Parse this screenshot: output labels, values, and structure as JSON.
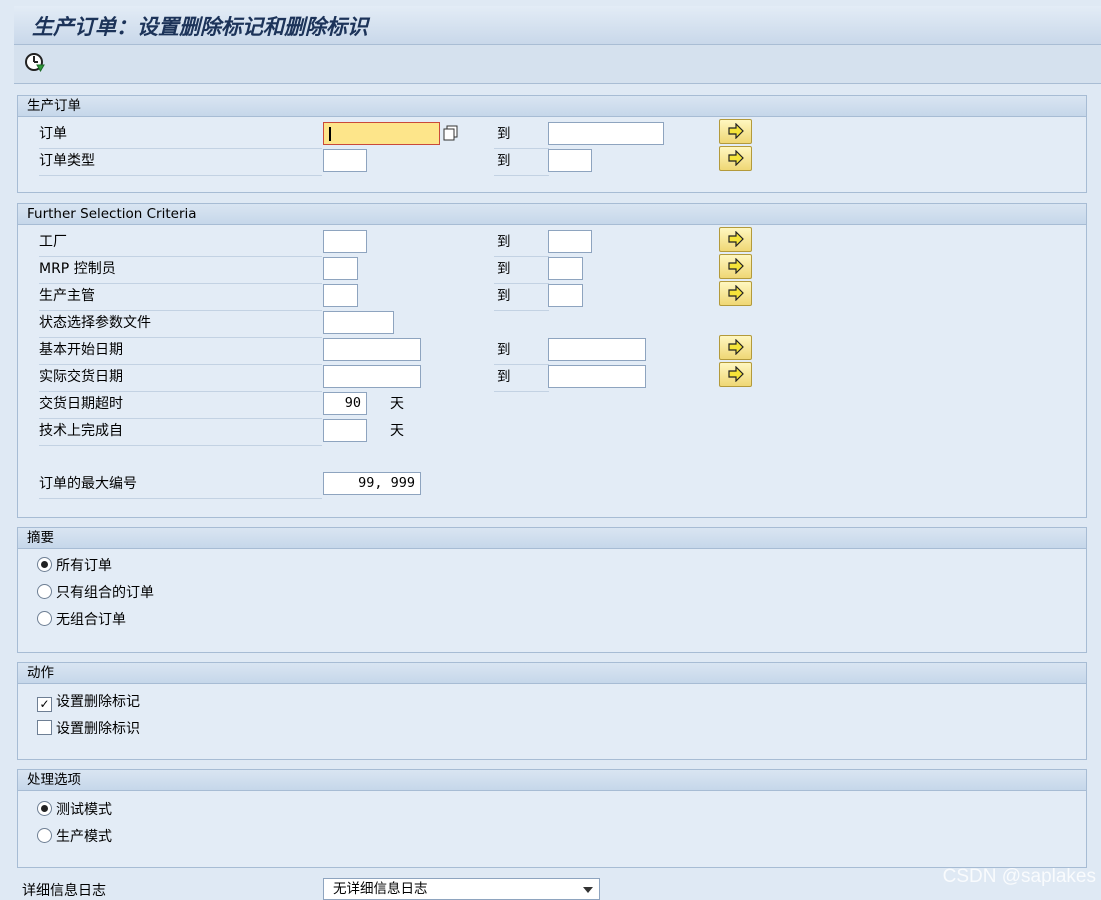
{
  "window": {
    "title": "生产订单：设置删除标记和删除标识"
  },
  "toolbar": {
    "execute_icon": "execute-clock-icon"
  },
  "to_label": "到",
  "groups": {
    "production_order": {
      "title": "生产订单",
      "order": {
        "label": "订单",
        "value": ""
      },
      "order_type": {
        "label": "订单类型"
      }
    },
    "further": {
      "title": "Further Selection Criteria",
      "plant": {
        "label": "工厂"
      },
      "mrp_controller": {
        "label": "MRP 控制员"
      },
      "prod_supervisor": {
        "label": "生产主管"
      },
      "status_profile": {
        "label": "状态选择参数文件"
      },
      "basic_start_date": {
        "label": "基本开始日期"
      },
      "actual_delivery_date": {
        "label": "实际交货日期"
      },
      "delivery_overdue": {
        "label": "交货日期超时",
        "value": "90",
        "unit": "天"
      },
      "tech_complete": {
        "label": "技术上完成自",
        "unit": "天"
      },
      "max_orders": {
        "label": "订单的最大编号",
        "value": "99, 999"
      }
    },
    "summary": {
      "title": "摘要",
      "options": [
        {
          "label": "所有订单",
          "selected": true
        },
        {
          "label": "只有组合的订单",
          "selected": false
        },
        {
          "label": "无组合订单",
          "selected": false
        }
      ]
    },
    "action": {
      "title": "动作",
      "options": [
        {
          "label": "设置删除标记",
          "checked": true,
          "mark": "✓"
        },
        {
          "label": "设置删除标识",
          "checked": false,
          "mark": ""
        }
      ]
    },
    "processing": {
      "title": "处理选项",
      "options": [
        {
          "label": "测试模式",
          "selected": true
        },
        {
          "label": "生产模式",
          "selected": false
        }
      ]
    }
  },
  "detail_log": {
    "label": "详细信息日志",
    "value": "无详细信息日志"
  },
  "watermark": "CSDN @saplakes",
  "colors": {
    "title": "#1c3359",
    "background": "#dfe9f4",
    "active_input": "#fde58a",
    "more_button": "#efd775"
  }
}
